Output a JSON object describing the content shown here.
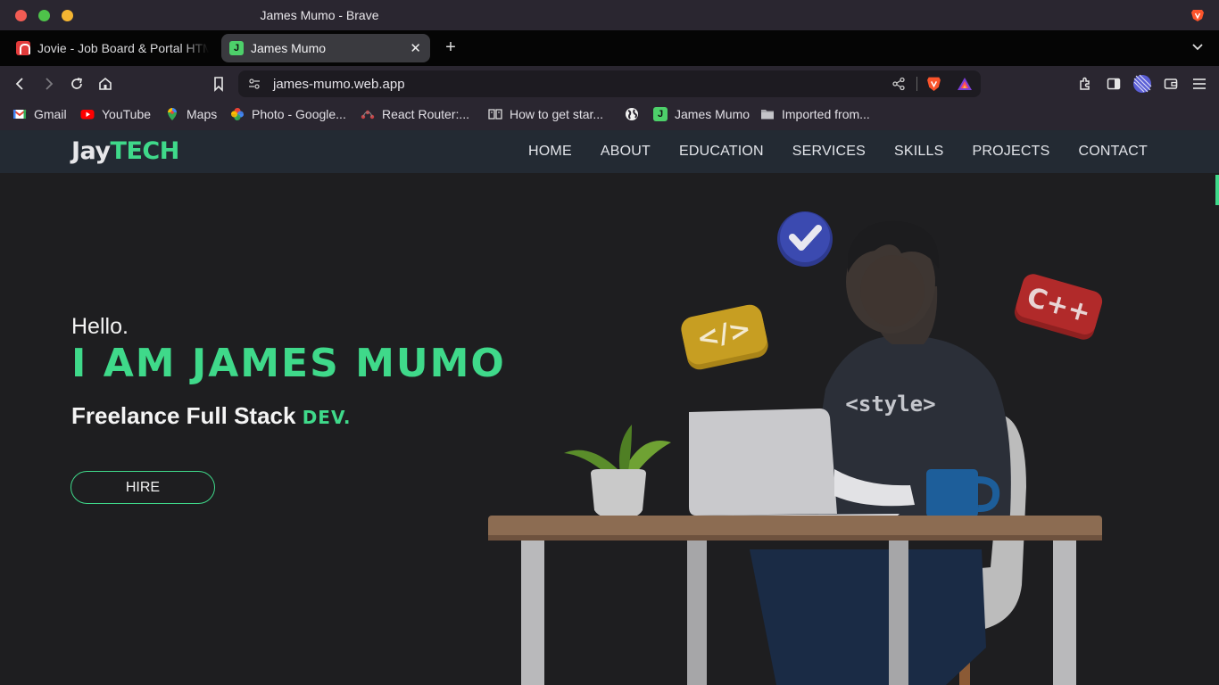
{
  "browser": {
    "window_title": "James Mumo - Brave",
    "tabs": [
      {
        "label": "Jovie - Job Board & Portal HTML",
        "active": false
      },
      {
        "label": "James Mumo",
        "active": true
      }
    ],
    "url": "james-mumo.web.app",
    "bookmarks": [
      {
        "label": "Gmail",
        "icon": "gmail-icon"
      },
      {
        "label": "YouTube",
        "icon": "youtube-icon"
      },
      {
        "label": "Maps",
        "icon": "maps-icon"
      },
      {
        "label": "Photo - Google...",
        "icon": "google-photos-icon"
      },
      {
        "label": "React Router:...",
        "icon": "react-router-icon"
      },
      {
        "label": "How to get star...",
        "icon": "book-icon"
      },
      {
        "label": "",
        "icon": "globe-icon"
      },
      {
        "label": "James Mumo",
        "icon": "j-favicon"
      },
      {
        "label": "Imported from...",
        "icon": "folder-icon"
      }
    ]
  },
  "site": {
    "logo": {
      "part1": "Jay",
      "part2": "TECH"
    },
    "nav": [
      "HOME",
      "ABOUT",
      "EDUCATION",
      "SERVICES",
      "SKILLS",
      "PROJECTS",
      "CONTACT"
    ],
    "hero": {
      "greeting": "Hello.",
      "name": "I AM JAMES MUMO",
      "role": "Freelance Full Stack",
      "role_accent": "DEV.",
      "button": "HIRE"
    },
    "illustration": {
      "hoodie_text": "<style>",
      "badge_code": "</>",
      "badge_lang": "C++"
    }
  },
  "colors": {
    "accent": "#3fd98a",
    "background": "#1e1e20",
    "navbar": "#232a33"
  }
}
